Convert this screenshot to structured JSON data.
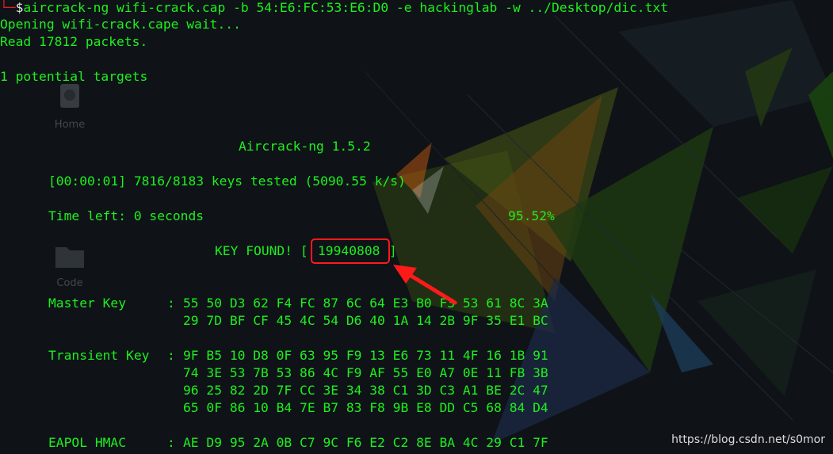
{
  "prompt": {
    "corner": "└─",
    "dollar": "$",
    "command": "aircrack-ng wifi-crack.cap -b 54:E6:FC:53:E6:D0 -e hackinglab -w ../Desktop/dic.txt"
  },
  "output": {
    "opening": "Opening wifi-crack.cape wait...",
    "read": "Read 17812 packets.",
    "targets": "1 potential targets"
  },
  "aircrack": {
    "title": "Aircrack-ng 1.5.2",
    "progress": "[00:00:01] 7816/8183 keys tested (5090.55 k/s)",
    "time_left": "Time left: 0 seconds",
    "percent": "95.52%",
    "key_found_prefix": "KEY FOUND! [",
    "key": "19940808",
    "key_found_suffix": "]",
    "master_key_label": "Master Key",
    "master_key": [
      "55 50 D3 62 F4 FC 87 6C 64 E3 B0 F3 53 61 8C 3A",
      "29 7D BF CF 45 4C 54 D6 40 1A 14 2B 9F 35 E1 BC"
    ],
    "transient_key_label": "Transient Key",
    "transient_key": [
      "9F B5 10 D8 0F 63 95 F9 13 E6 73 11 4F 16 1B 91",
      "74 3E 53 7B 53 86 4C F9 AF 55 E0 A7 0E 11 FB 3B",
      "96 25 82 2D 7F CC 3E 34 38 C1 3D C3 A1 BE 2C 47",
      "65 0F 86 10 B4 7E B7 83 F8 9B E8 DD C5 68 84 D4"
    ],
    "eapol_label": "EAPOL HMAC",
    "eapol": "AE D9 95 2A 0B C7 9C F6 E2 C2 8E BA 4C 29 C1 7F",
    "colon": ":"
  },
  "desktop_icons": [
    "Home",
    "Code"
  ],
  "watermark": "https://blog.csdn.net/s0mor",
  "colors": {
    "terminal_text": "#1df01d",
    "highlight": "#ff1a1a",
    "prompt_corner": "#d81f1f"
  }
}
